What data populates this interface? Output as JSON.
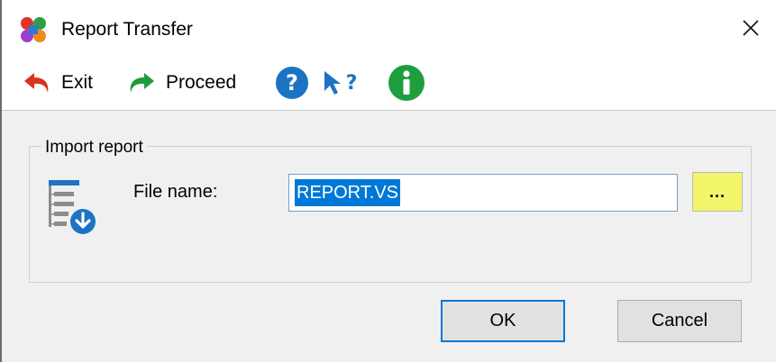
{
  "window": {
    "title": "Report Transfer"
  },
  "toolbar": {
    "exit_label": "Exit",
    "proceed_label": "Proceed",
    "colors": {
      "exit": "#d9341c",
      "proceed": "#1e9b3c",
      "help": "#1c73c4",
      "info": "#1f9e3f",
      "whats_this": "#1c73c4"
    }
  },
  "import_group": {
    "title": "Import report",
    "file_label": "File name:",
    "file_value": "REPORT.VS",
    "browse_label": "..."
  },
  "buttons": {
    "ok": "OK",
    "cancel": "Cancel"
  }
}
